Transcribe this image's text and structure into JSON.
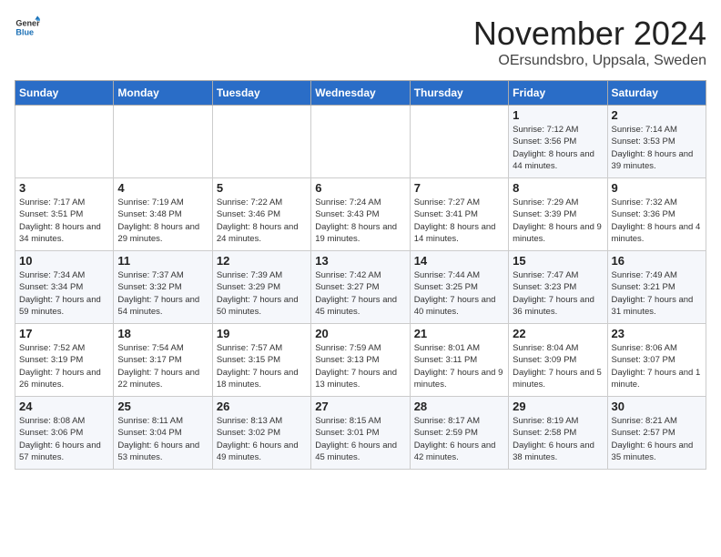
{
  "logo": {
    "general": "General",
    "blue": "Blue"
  },
  "title": "November 2024",
  "location": "OErsundsbro, Uppsala, Sweden",
  "days_of_week": [
    "Sunday",
    "Monday",
    "Tuesday",
    "Wednesday",
    "Thursday",
    "Friday",
    "Saturday"
  ],
  "weeks": [
    [
      {
        "day": "",
        "info": ""
      },
      {
        "day": "",
        "info": ""
      },
      {
        "day": "",
        "info": ""
      },
      {
        "day": "",
        "info": ""
      },
      {
        "day": "",
        "info": ""
      },
      {
        "day": "1",
        "info": "Sunrise: 7:12 AM\nSunset: 3:56 PM\nDaylight: 8 hours and 44 minutes."
      },
      {
        "day": "2",
        "info": "Sunrise: 7:14 AM\nSunset: 3:53 PM\nDaylight: 8 hours and 39 minutes."
      }
    ],
    [
      {
        "day": "3",
        "info": "Sunrise: 7:17 AM\nSunset: 3:51 PM\nDaylight: 8 hours and 34 minutes."
      },
      {
        "day": "4",
        "info": "Sunrise: 7:19 AM\nSunset: 3:48 PM\nDaylight: 8 hours and 29 minutes."
      },
      {
        "day": "5",
        "info": "Sunrise: 7:22 AM\nSunset: 3:46 PM\nDaylight: 8 hours and 24 minutes."
      },
      {
        "day": "6",
        "info": "Sunrise: 7:24 AM\nSunset: 3:43 PM\nDaylight: 8 hours and 19 minutes."
      },
      {
        "day": "7",
        "info": "Sunrise: 7:27 AM\nSunset: 3:41 PM\nDaylight: 8 hours and 14 minutes."
      },
      {
        "day": "8",
        "info": "Sunrise: 7:29 AM\nSunset: 3:39 PM\nDaylight: 8 hours and 9 minutes."
      },
      {
        "day": "9",
        "info": "Sunrise: 7:32 AM\nSunset: 3:36 PM\nDaylight: 8 hours and 4 minutes."
      }
    ],
    [
      {
        "day": "10",
        "info": "Sunrise: 7:34 AM\nSunset: 3:34 PM\nDaylight: 7 hours and 59 minutes."
      },
      {
        "day": "11",
        "info": "Sunrise: 7:37 AM\nSunset: 3:32 PM\nDaylight: 7 hours and 54 minutes."
      },
      {
        "day": "12",
        "info": "Sunrise: 7:39 AM\nSunset: 3:29 PM\nDaylight: 7 hours and 50 minutes."
      },
      {
        "day": "13",
        "info": "Sunrise: 7:42 AM\nSunset: 3:27 PM\nDaylight: 7 hours and 45 minutes."
      },
      {
        "day": "14",
        "info": "Sunrise: 7:44 AM\nSunset: 3:25 PM\nDaylight: 7 hours and 40 minutes."
      },
      {
        "day": "15",
        "info": "Sunrise: 7:47 AM\nSunset: 3:23 PM\nDaylight: 7 hours and 36 minutes."
      },
      {
        "day": "16",
        "info": "Sunrise: 7:49 AM\nSunset: 3:21 PM\nDaylight: 7 hours and 31 minutes."
      }
    ],
    [
      {
        "day": "17",
        "info": "Sunrise: 7:52 AM\nSunset: 3:19 PM\nDaylight: 7 hours and 26 minutes."
      },
      {
        "day": "18",
        "info": "Sunrise: 7:54 AM\nSunset: 3:17 PM\nDaylight: 7 hours and 22 minutes."
      },
      {
        "day": "19",
        "info": "Sunrise: 7:57 AM\nSunset: 3:15 PM\nDaylight: 7 hours and 18 minutes."
      },
      {
        "day": "20",
        "info": "Sunrise: 7:59 AM\nSunset: 3:13 PM\nDaylight: 7 hours and 13 minutes."
      },
      {
        "day": "21",
        "info": "Sunrise: 8:01 AM\nSunset: 3:11 PM\nDaylight: 7 hours and 9 minutes."
      },
      {
        "day": "22",
        "info": "Sunrise: 8:04 AM\nSunset: 3:09 PM\nDaylight: 7 hours and 5 minutes."
      },
      {
        "day": "23",
        "info": "Sunrise: 8:06 AM\nSunset: 3:07 PM\nDaylight: 7 hours and 1 minute."
      }
    ],
    [
      {
        "day": "24",
        "info": "Sunrise: 8:08 AM\nSunset: 3:06 PM\nDaylight: 6 hours and 57 minutes."
      },
      {
        "day": "25",
        "info": "Sunrise: 8:11 AM\nSunset: 3:04 PM\nDaylight: 6 hours and 53 minutes."
      },
      {
        "day": "26",
        "info": "Sunrise: 8:13 AM\nSunset: 3:02 PM\nDaylight: 6 hours and 49 minutes."
      },
      {
        "day": "27",
        "info": "Sunrise: 8:15 AM\nSunset: 3:01 PM\nDaylight: 6 hours and 45 minutes."
      },
      {
        "day": "28",
        "info": "Sunrise: 8:17 AM\nSunset: 2:59 PM\nDaylight: 6 hours and 42 minutes."
      },
      {
        "day": "29",
        "info": "Sunrise: 8:19 AM\nSunset: 2:58 PM\nDaylight: 6 hours and 38 minutes."
      },
      {
        "day": "30",
        "info": "Sunrise: 8:21 AM\nSunset: 2:57 PM\nDaylight: 6 hours and 35 minutes."
      }
    ]
  ]
}
